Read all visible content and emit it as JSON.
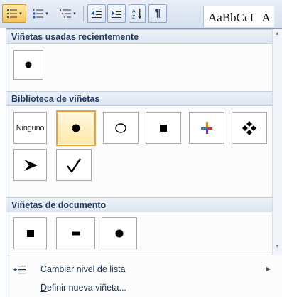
{
  "ribbon": {
    "style_preview_text": "AaBbCcI",
    "style_preview_next": "A",
    "pilcrow": "¶",
    "caret": "▾"
  },
  "sections": {
    "recent": "Viñetas usadas recientemente",
    "library": "Biblioteca de viñetas",
    "document": "Viñetas de documento"
  },
  "library": {
    "none_label": "Ninguno"
  },
  "menu": {
    "change_level_underlined": "C",
    "change_level_rest": "ambiar nivel de lista",
    "define_new_underlined": "D",
    "define_new_rest": "efinir nueva viñeta..."
  },
  "colors": {
    "selection_border": "#e7a33e",
    "section_text": "#1e3a5f",
    "accent_blue": "#1f5fae"
  },
  "icons": [
    "bullets-icon",
    "numbering-icon",
    "multilevel-list-icon",
    "decrease-indent-icon",
    "increase-indent-icon",
    "sort-icon",
    "show-marks-icon",
    "change-list-level-icon"
  ]
}
